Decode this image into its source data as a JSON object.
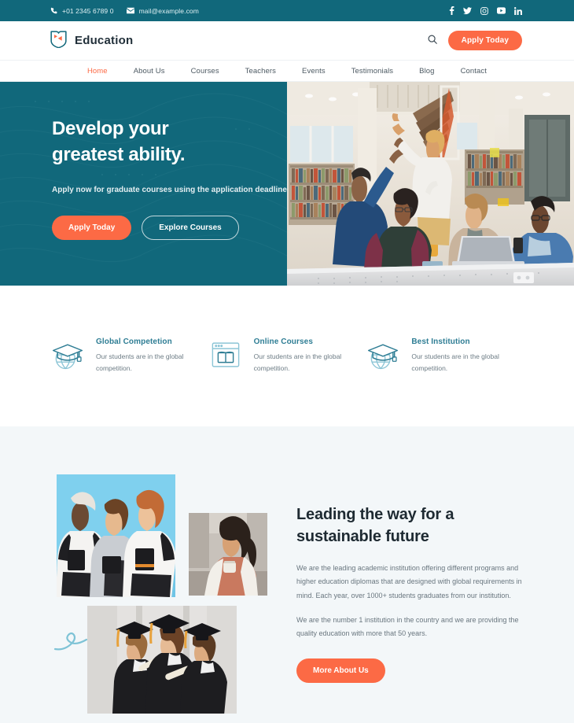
{
  "topbar": {
    "phone": "+01 2345 6789 0",
    "email": "mail@example.com",
    "phone_icon": "phone-icon",
    "email_icon": "envelope-icon",
    "socials": [
      {
        "name": "facebook-icon",
        "label": "f"
      },
      {
        "name": "twitter-icon",
        "label": "t"
      },
      {
        "name": "instagram-icon",
        "label": "ig"
      },
      {
        "name": "youtube-icon",
        "label": "yt"
      },
      {
        "name": "linkedin-icon",
        "label": "in"
      }
    ],
    "bg_color": "#11687B"
  },
  "header": {
    "brand_name": "Education",
    "logo_icon": "shield-book-logo-icon",
    "search_icon": "search-icon",
    "apply_label": "Apply Today"
  },
  "nav": {
    "items": [
      {
        "label": "Home",
        "active": true
      },
      {
        "label": "About Us",
        "active": false
      },
      {
        "label": "Courses",
        "active": false
      },
      {
        "label": "Teachers",
        "active": false
      },
      {
        "label": "Events",
        "active": false
      },
      {
        "label": "Testimonials",
        "active": false
      },
      {
        "label": "Blog",
        "active": false
      },
      {
        "label": "Contact",
        "active": false
      }
    ]
  },
  "hero": {
    "heading_line1": "Develop your",
    "heading_line2": "greatest ability.",
    "subtext": "Apply now for graduate courses using the application deadline",
    "primary_button": "Apply Today",
    "secondary_button": "Explore Courses",
    "image_alt": "students-high-five-library-photo",
    "bg_color": "#11687B"
  },
  "features": [
    {
      "icon": "globe-graduation-cap-icon",
      "title": "Global Competetion",
      "text": "Our students are in the global competition."
    },
    {
      "icon": "browser-open-book-icon",
      "title": "Online Courses",
      "text": "Our students are in the global competition."
    },
    {
      "icon": "globe-graduation-cap-icon",
      "title": "Best Institution",
      "text": "Our students are in the global competition."
    }
  ],
  "about": {
    "heading_line1": "Leading the way for a",
    "heading_line2": "sustainable future",
    "paragraph1": "We are the leading academic institution offering different programs and higher education diplomas that are designed with global requirements in mind. Each year, over 1000+ students graduates from our institution.",
    "paragraph2": "We are the number 1 institution in the country and we are providing the quality education with more that 50 years.",
    "button_label": "More About Us",
    "images": [
      {
        "name": "students-with-backpacks-photo"
      },
      {
        "name": "woman-with-coffee-photo"
      },
      {
        "name": "graduates-in-caps-photo"
      }
    ],
    "decoration": "squiggle-loop-decoration",
    "bg_color": "#F3F7F9"
  },
  "theme": {
    "teal": "#11687B",
    "orange": "#FC6A45",
    "light_teal": "#7EC3D6",
    "dark_text": "#1e2a32"
  }
}
